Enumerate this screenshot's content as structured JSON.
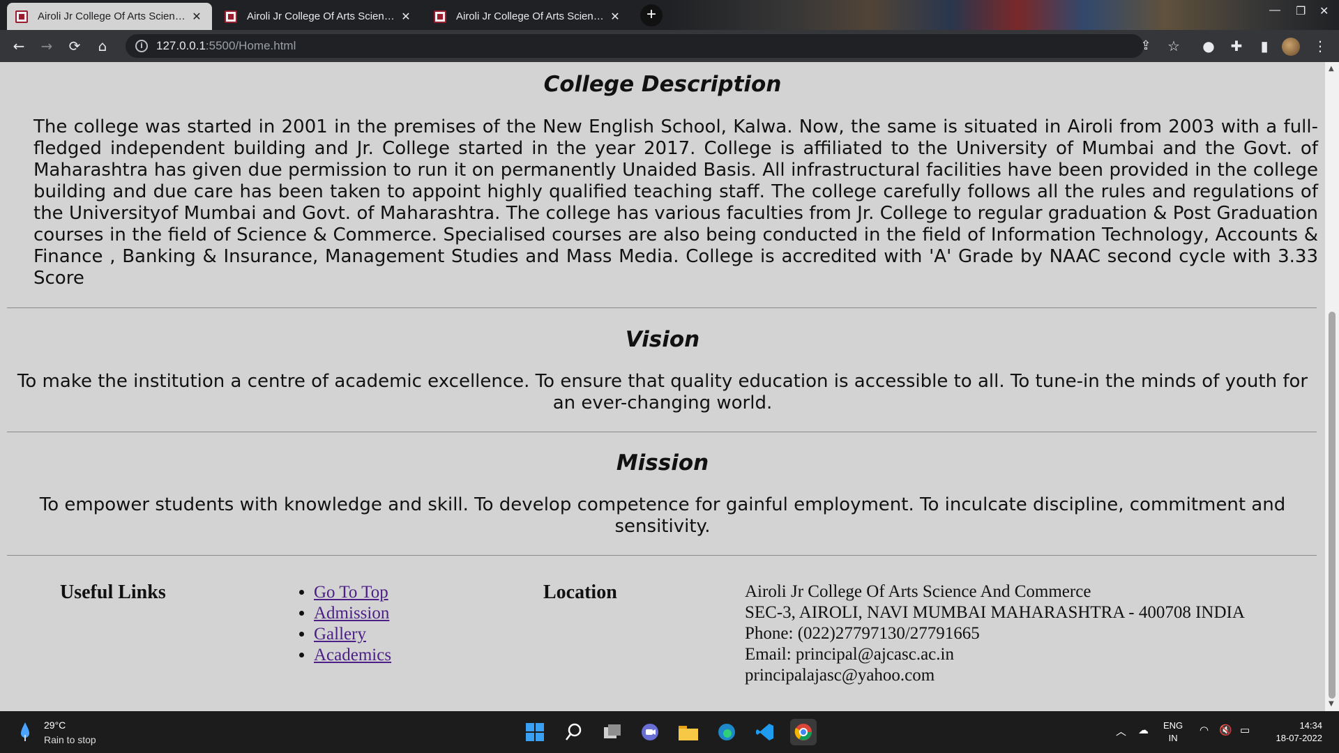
{
  "browser": {
    "tabs": [
      {
        "title": "Airoli Jr College Of Arts Science A",
        "active": true
      },
      {
        "title": "Airoli Jr College Of Arts Science A",
        "active": false
      },
      {
        "title": "Airoli Jr College Of Arts Science A",
        "active": false
      }
    ],
    "close_glyph": "✕",
    "new_tab_glyph": "+",
    "url_host": "127.0.0.1",
    "url_rest": ":5500/Home.html"
  },
  "page": {
    "description": {
      "title": "College Description",
      "text": "The college was started in 2001 in the premises of the New English School, Kalwa. Now, the same is situated in Airoli from 2003 with a full-fledged independent building and Jr. College started in the year 2017. College is affiliated to the University of Mumbai and the Govt. of Maharashtra has given due permission to run it on permanently Unaided Basis. All infrastructural facilities have been provided in the college building and due care has been taken to appoint highly qualified teaching staff. The college carefully follows all the rules and regulations of the Universityof Mumbai and Govt. of Maharashtra. The college has various faculties from Jr. College to regular graduation & Post Graduation courses in the field of Science & Commerce. Specialised courses are also being conducted in the field of Information Technology, Accounts & Finance , Banking & Insurance, Management Studies and Mass Media. College is accredited with 'A' Grade by NAAC second cycle with 3.33 Score"
    },
    "vision": {
      "title": "Vision",
      "text": "To make the institution a centre of academic excellence. To ensure that quality education is accessible to all. To tune-in the minds of youth for an ever-changing world."
    },
    "mission": {
      "title": "Mission",
      "text": "To empower students with knowledge and skill. To develop competence for gainful employment. To inculcate discipline, commitment and sensitivity."
    },
    "footer": {
      "useful_links_heading": "Useful Links",
      "links": [
        "Go To Top",
        "Admission",
        "Gallery",
        "Academics"
      ],
      "location_heading": "Location",
      "address_lines": [
        "Airoli Jr College Of Arts Science And Commerce",
        "SEC-3, AIROLI, NAVI MUMBAI MAHARASHTRA - 400708 INDIA",
        "Phone: (022)27797130/27791665",
        "Email: principal@ajcasc.ac.in",
        "principalajasc@yahoo.com"
      ]
    }
  },
  "taskbar": {
    "weather_temp": "29°C",
    "weather_desc": "Rain to stop",
    "lang_top": "ENG",
    "lang_bottom": "IN",
    "time": "14:34",
    "date": "18-07-2022"
  },
  "colors": {
    "page_bg": "#d3d3d3",
    "link": "#4b1f86",
    "chrome_dark": "#202124",
    "toolbar": "#35363a",
    "taskbar": "#1c1c1c"
  }
}
